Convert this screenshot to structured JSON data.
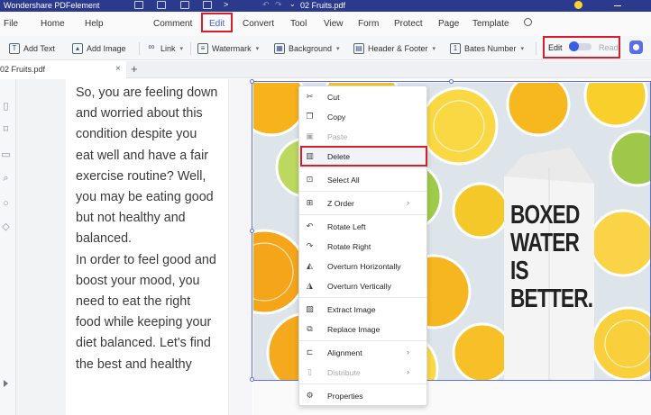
{
  "titlebar": {
    "app_name": "Wondershare PDFelement",
    "doc_name": "02 Fruits.pdf"
  },
  "menu": {
    "items": [
      "File",
      "Home",
      "Help",
      "Comment",
      "Edit",
      "Convert",
      "Tool",
      "View",
      "Form",
      "Protect",
      "Page",
      "Template"
    ],
    "active": "Edit"
  },
  "toolbar": {
    "add_text": "Add Text",
    "add_image": "Add Image",
    "link": "Link",
    "watermark": "Watermark",
    "background": "Background",
    "header_footer": "Header & Footer",
    "bates_number": "Bates Number",
    "edit_label": "Edit",
    "read_label": "Read"
  },
  "tab": {
    "label": "02 Fruits.pdf"
  },
  "document": {
    "lines": [
      "So, you are feeling down",
      "and worried about this",
      "condition despite you",
      "eat well and have a fair",
      "exercise routine? Well,",
      "you may be eating good",
      "but not healthy and",
      "balanced.",
      "In order to feel good and",
      "boost your mood, you",
      "need to eat the right",
      "food while keeping your",
      "diet balanced. Let's find",
      "the best and healthy"
    ]
  },
  "photo": {
    "carton_text": [
      "BOXED",
      "WATER",
      "IS",
      "BETTER."
    ]
  },
  "context_menu": {
    "items": [
      {
        "label": "Cut",
        "icon": "scissors-icon",
        "disabled": false
      },
      {
        "label": "Copy",
        "icon": "copy-icon",
        "disabled": false
      },
      {
        "label": "Paste",
        "icon": "paste-icon",
        "disabled": true
      },
      {
        "label": "Delete",
        "icon": "trash-icon",
        "disabled": false
      },
      {
        "label": "Select All",
        "icon": "select-all-icon",
        "disabled": false
      },
      {
        "label": "Z Order",
        "icon": "z-order-icon",
        "disabled": false
      },
      {
        "label": "Rotate Left",
        "icon": "rotate-left-icon",
        "disabled": false
      },
      {
        "label": "Rotate Right",
        "icon": "rotate-right-icon",
        "disabled": false
      },
      {
        "label": "Overturn Horizontally",
        "icon": "flip-horizontal-icon",
        "disabled": false
      },
      {
        "label": "Overturn Vertically",
        "icon": "flip-vertical-icon",
        "disabled": false
      },
      {
        "label": "Extract Image",
        "icon": "extract-image-icon",
        "disabled": false
      },
      {
        "label": "Replace Image",
        "icon": "replace-image-icon",
        "disabled": false
      },
      {
        "label": "Alignment",
        "icon": "alignment-icon",
        "disabled": false
      },
      {
        "label": "Distribute",
        "icon": "distribute-icon",
        "disabled": true
      },
      {
        "label": "Properties",
        "icon": "gear-icon",
        "disabled": false
      }
    ]
  },
  "colors": {
    "accent": "#3b5ce4",
    "highlight": "#d81e2a",
    "titlebar": "#2b3a8c"
  }
}
